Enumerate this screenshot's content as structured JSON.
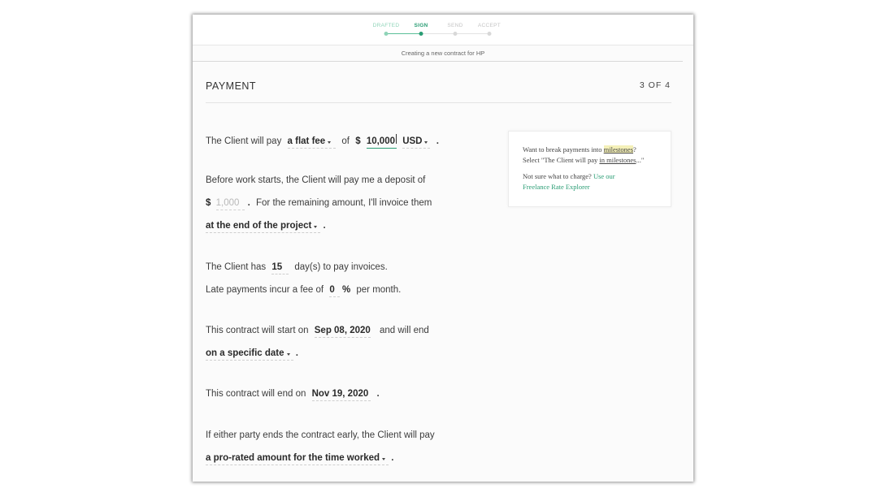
{
  "stepper": {
    "steps": [
      {
        "label": "DRAFTED"
      },
      {
        "label": "SIGN"
      },
      {
        "label": "SEND"
      },
      {
        "label": "ACCEPT"
      }
    ]
  },
  "subheader": "Creating a new contract for HP",
  "section": {
    "title": "PAYMENT",
    "progress": "3 OF 4"
  },
  "payment": {
    "pay_prefix": "The Client will pay",
    "fee_type": "a flat fee",
    "of_text": "of",
    "currency_symbol": "$",
    "amount": "10,000",
    "currency": "USD",
    "period": "."
  },
  "deposit": {
    "line1": "Before work starts, the Client will pay me a deposit of",
    "currency_symbol": "$",
    "placeholder": "1,000",
    "remaining_text": "For the remaining amount, I'll invoice them",
    "invoice_timing": "at the end of the project"
  },
  "terms": {
    "days_prefix": "The Client has",
    "days_value": "15",
    "days_suffix": "day(s) to pay invoices.",
    "late_prefix": "Late payments incur a fee of",
    "late_value": "0",
    "late_unit": "%",
    "late_suffix": "per month."
  },
  "dates": {
    "start_prefix": "This contract will start on",
    "start_date": "Sep 08, 2020",
    "start_suffix": "and will end",
    "end_type": "on a specific date",
    "end_prefix": "This contract will end on",
    "end_date": "Nov 19, 2020"
  },
  "termination": {
    "text": "If either party ends the contract early, the Client will pay",
    "option": "a pro-rated amount for the time worked"
  },
  "tip": {
    "q1_before": "Want to break payments into ",
    "q1_highlight": "milestones",
    "q1_after": "?",
    "q2_before": "Select \"The Client will pay ",
    "q2_underline": "in milestones",
    "q2_after": "...\"",
    "q3": "Not sure what to charge? ",
    "link1": "Use our",
    "link2": "Freelance Rate Explorer"
  }
}
